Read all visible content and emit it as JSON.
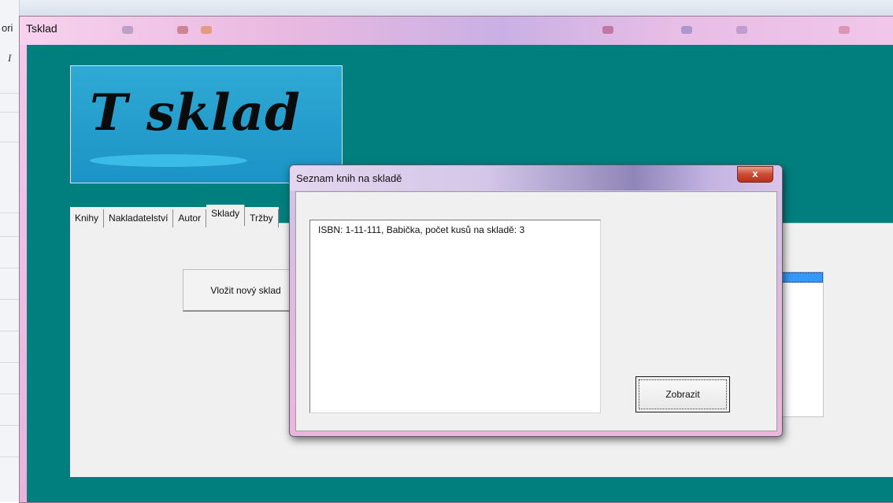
{
  "background_app": {
    "left_label": "ori",
    "left_italic": "I"
  },
  "main_window": {
    "title": "Tsklad",
    "logo_text": "T sklad",
    "tabs": [
      {
        "label": "Knihy"
      },
      {
        "label": "Nakladatelství"
      },
      {
        "label": "Autor"
      },
      {
        "label": "Sklady",
        "active": true
      },
      {
        "label": "Tržby"
      }
    ],
    "insert_button_label": "Vložit nový sklad",
    "colors": {
      "client_background": "#007f7f",
      "logo_background": "#1b93c6",
      "selection": "#3399ff"
    }
  },
  "dialog": {
    "title": "Seznam knih na skladě",
    "close_label": "x",
    "list_items": [
      "ISBN: 1-11-111, Babička, počet kusů na skladě: 3"
    ],
    "show_button_label": "Zobrazit"
  }
}
